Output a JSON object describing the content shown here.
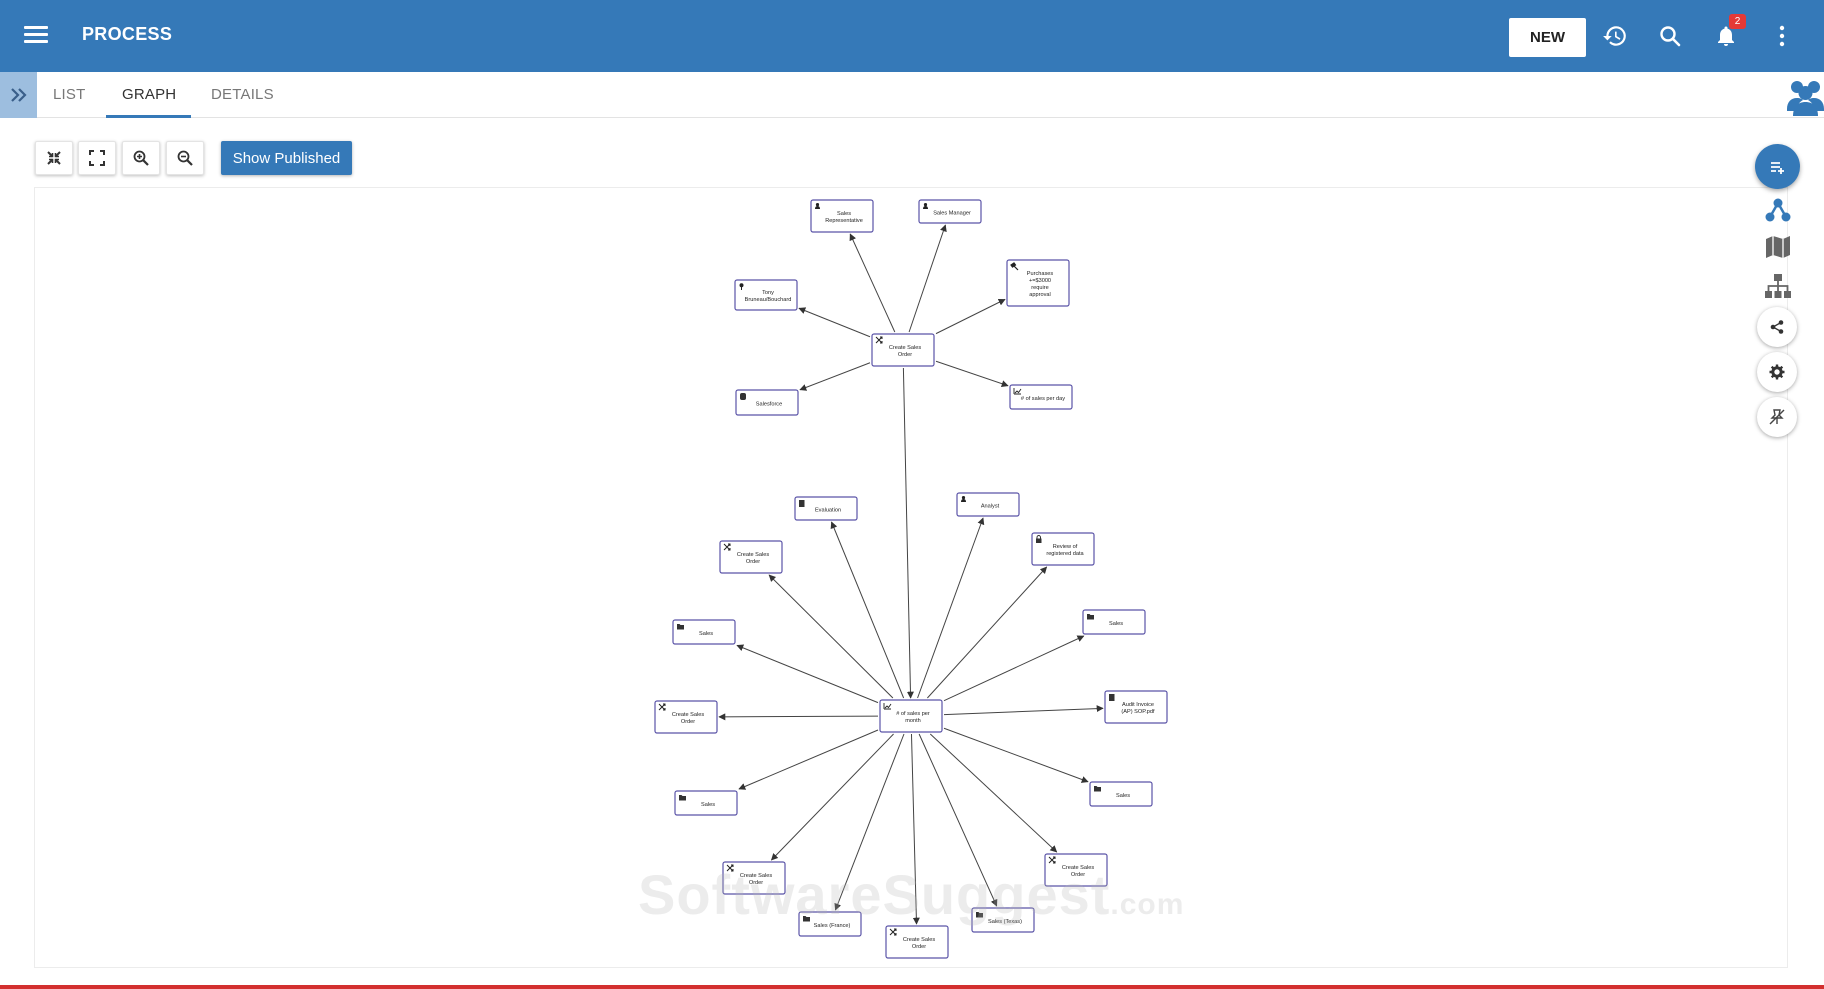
{
  "app": {
    "title": "PROCESS",
    "new_label": "NEW",
    "notification_count": "2"
  },
  "tabs": [
    {
      "label": "LIST",
      "active": false
    },
    {
      "label": "GRAPH",
      "active": true
    },
    {
      "label": "DETAILS",
      "active": false
    }
  ],
  "toolbar": {
    "show_published_label": "Show Published"
  },
  "watermark": {
    "main": "SoftwareSuggest",
    "suffix": ".com"
  },
  "colors": {
    "brand": "#3579b8",
    "badge": "#e53935",
    "node_border": "#5b54a8"
  },
  "graph": {
    "nodes": [
      {
        "id": "sales-rep",
        "label": [
          "Sales",
          "Representative"
        ],
        "icon": "person"
      },
      {
        "id": "sales-manager",
        "label": [
          "Sales Manager"
        ],
        "icon": "person"
      },
      {
        "id": "purchases",
        "label": [
          "Purchases",
          "+=$3000",
          "require",
          "approval"
        ],
        "icon": "gavel"
      },
      {
        "id": "tony",
        "label": [
          "Tony",
          "Bruneau/Bouchard"
        ],
        "icon": "pin"
      },
      {
        "id": "create-sales-order-top",
        "label": [
          "Create Sales",
          "Order"
        ],
        "icon": "shuffle"
      },
      {
        "id": "salesforce",
        "label": [
          "Salesforce"
        ],
        "icon": "database"
      },
      {
        "id": "sales-per-day",
        "label": [
          "# of sales per day"
        ],
        "icon": "chart"
      },
      {
        "id": "evaluation",
        "label": [
          "Evaluation"
        ],
        "icon": "doc"
      },
      {
        "id": "analyst",
        "label": [
          "Analyst"
        ],
        "icon": "person"
      },
      {
        "id": "review",
        "label": [
          "Review of",
          "registered data"
        ],
        "icon": "lock"
      },
      {
        "id": "cso-left-upper",
        "label": [
          "Create Sales",
          "Order"
        ],
        "icon": "shuffle"
      },
      {
        "id": "sales-left-upper",
        "label": [
          "Sales"
        ],
        "icon": "folder"
      },
      {
        "id": "sales-right-upper",
        "label": [
          "Sales"
        ],
        "icon": "folder"
      },
      {
        "id": "sales-per-month",
        "label": [
          "# of sales per",
          "month"
        ],
        "icon": "chart"
      },
      {
        "id": "cso-left-mid",
        "label": [
          "Create Sales",
          "Order"
        ],
        "icon": "shuffle"
      },
      {
        "id": "audit",
        "label": [
          "Audit Invoice",
          "(AP) SOP.pdf"
        ],
        "icon": "doc"
      },
      {
        "id": "sales-left-lower",
        "label": [
          "Sales"
        ],
        "icon": "folder"
      },
      {
        "id": "sales-right-lower",
        "label": [
          "Sales"
        ],
        "icon": "folder"
      },
      {
        "id": "cso-bottom-left",
        "label": [
          "Create Sales",
          "Order"
        ],
        "icon": "shuffle"
      },
      {
        "id": "cso-bottom-right",
        "label": [
          "Create Sales",
          "Order"
        ],
        "icon": "shuffle"
      },
      {
        "id": "sales-france",
        "label": [
          "Sales (France)"
        ],
        "icon": "folder"
      },
      {
        "id": "sales-texas",
        "label": [
          "Sales (Texas)"
        ],
        "icon": "folder"
      },
      {
        "id": "cso-bottom",
        "label": [
          "Create Sales",
          "Order"
        ],
        "icon": "shuffle"
      }
    ],
    "edges": [
      [
        "create-sales-order-top",
        "sales-rep"
      ],
      [
        "create-sales-order-top",
        "sales-manager"
      ],
      [
        "create-sales-order-top",
        "purchases"
      ],
      [
        "create-sales-order-top",
        "tony"
      ],
      [
        "create-sales-order-top",
        "salesforce"
      ],
      [
        "create-sales-order-top",
        "sales-per-day"
      ],
      [
        "create-sales-order-top",
        "sales-per-month"
      ],
      [
        "sales-per-month",
        "evaluation"
      ],
      [
        "sales-per-month",
        "analyst"
      ],
      [
        "sales-per-month",
        "review"
      ],
      [
        "sales-per-month",
        "cso-left-upper"
      ],
      [
        "sales-per-month",
        "sales-left-upper"
      ],
      [
        "sales-per-month",
        "sales-right-upper"
      ],
      [
        "sales-per-month",
        "cso-left-mid"
      ],
      [
        "sales-per-month",
        "audit"
      ],
      [
        "sales-per-month",
        "sales-left-lower"
      ],
      [
        "sales-per-month",
        "sales-right-lower"
      ],
      [
        "sales-per-month",
        "cso-bottom-left"
      ],
      [
        "sales-per-month",
        "cso-bottom-right"
      ],
      [
        "sales-per-month",
        "sales-france"
      ],
      [
        "sales-per-month",
        "sales-texas"
      ],
      [
        "sales-per-month",
        "cso-bottom"
      ]
    ]
  }
}
